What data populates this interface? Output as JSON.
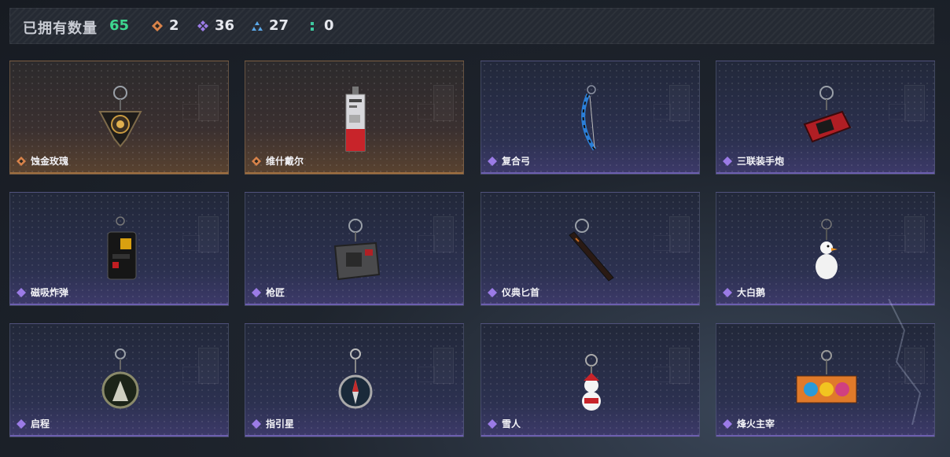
{
  "header": {
    "title": "已拥有数量",
    "total": "65",
    "stats": [
      {
        "icon": "orange-diamond-icon",
        "color": "#d9834a",
        "value": "2"
      },
      {
        "icon": "purple-diamond-icon",
        "color": "#9b7be6",
        "value": "36"
      },
      {
        "icon": "blue-triangle-icon",
        "color": "#5aa7e8",
        "value": "27"
      },
      {
        "icon": "green-dots-icon",
        "color": "#3ec9a0",
        "value": "0"
      }
    ]
  },
  "items": [
    {
      "name": "蚀金玫瑰",
      "rarity": "orange",
      "art": "rose-charm"
    },
    {
      "name": "维什戴尔",
      "rarity": "orange",
      "art": "tag-charm"
    },
    {
      "name": "复合弓",
      "rarity": "purple",
      "art": "bow-charm"
    },
    {
      "name": "三联装手炮",
      "rarity": "purple",
      "art": "cannon-charm"
    },
    {
      "name": "磁吸炸弹",
      "rarity": "purple",
      "art": "bomb-charm"
    },
    {
      "name": "枪匠",
      "rarity": "purple",
      "art": "plate-charm"
    },
    {
      "name": "仪典匕首",
      "rarity": "purple",
      "art": "dagger-charm"
    },
    {
      "name": "大白鹅",
      "rarity": "purple",
      "art": "goose-charm"
    },
    {
      "name": "启程",
      "rarity": "purple",
      "art": "medal-charm"
    },
    {
      "name": "指引星",
      "rarity": "purple",
      "art": "compass-charm"
    },
    {
      "name": "雪人",
      "rarity": "purple",
      "art": "snowman-charm"
    },
    {
      "name": "烽火主宰",
      "rarity": "purple",
      "art": "graffiti-charm"
    }
  ]
}
